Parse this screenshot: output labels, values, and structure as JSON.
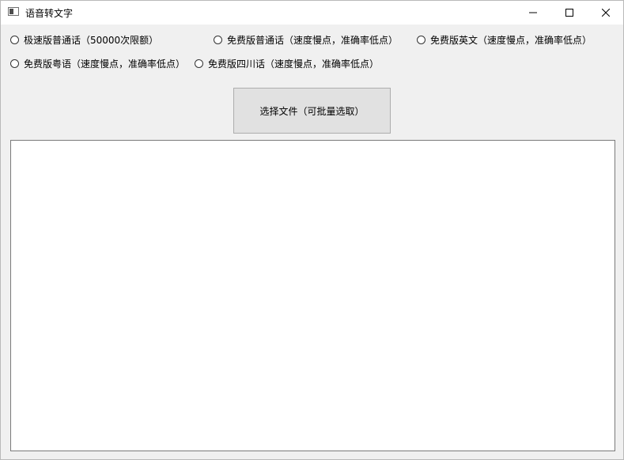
{
  "window": {
    "title": "语音转文字"
  },
  "options": [
    {
      "label": "极速版普通话（50000次限额）",
      "selected": false
    },
    {
      "label": "免费版普通话（速度慢点，准确率低点）",
      "selected": false
    },
    {
      "label": "免费版英文（速度慢点，准确率低点）",
      "selected": false
    },
    {
      "label": "免费版粤语（速度慢点，准确率低点）",
      "selected": false
    },
    {
      "label": "免费版四川话（速度慢点，准确率低点）",
      "selected": false
    }
  ],
  "select_button": {
    "label": "选择文件（可批量选取）"
  },
  "output": {
    "value": ""
  },
  "icons": {
    "app": "app-window-icon",
    "minimize": "minimize-icon",
    "maximize": "maximize-icon",
    "close": "close-icon",
    "radio": "radio-icon"
  }
}
